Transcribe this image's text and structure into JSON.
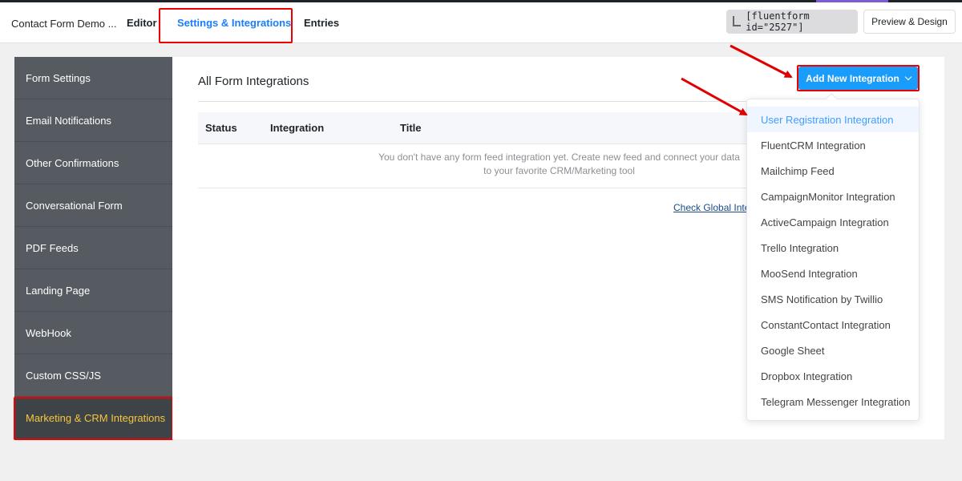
{
  "header": {
    "form_name": "Contact Form Demo ...",
    "tabs": [
      {
        "label": "Editor"
      },
      {
        "label": "Settings & Integrations",
        "active": true
      },
      {
        "label": "Entries"
      }
    ],
    "shortcode": "[fluentform id=\"2527\"]",
    "preview_label": "Preview & Design"
  },
  "sidebar": {
    "items": [
      {
        "label": "Form Settings"
      },
      {
        "label": "Email Notifications"
      },
      {
        "label": "Other Confirmations"
      },
      {
        "label": "Conversational Form"
      },
      {
        "label": "PDF Feeds"
      },
      {
        "label": "Landing Page"
      },
      {
        "label": "WebHook"
      },
      {
        "label": "Custom CSS/JS"
      },
      {
        "label": "Marketing & CRM Integrations",
        "active": true
      }
    ]
  },
  "main": {
    "title": "All Form Integrations",
    "add_button_label": "Add New Integration",
    "table": {
      "columns": [
        "Status",
        "Integration",
        "Title"
      ],
      "empty_line1": "You don't have any form feed integration yet. Create new feed and connect your data",
      "empty_line2": "to your favorite CRM/Marketing tool"
    },
    "global_link": "Check Global Integrations"
  },
  "dropdown": {
    "options": [
      "User Registration Integration",
      "FluentCRM Integration",
      "Mailchimp Feed",
      "CampaignMonitor Integration",
      "ActiveCampaign Integration",
      "Trello Integration",
      "MooSend Integration",
      "SMS Notification by Twillio",
      "ConstantContact Integration",
      "Google Sheet",
      "Dropbox Integration",
      "Telegram Messenger Integration"
    ],
    "highlighted_index": 0
  },
  "colors": {
    "accent": "#1a9cfb",
    "active_tab": "#1a7efb",
    "sidebar_bg": "#555b60",
    "sidebar_active_text": "#f7c63d",
    "annotation_red": "#e00000"
  }
}
